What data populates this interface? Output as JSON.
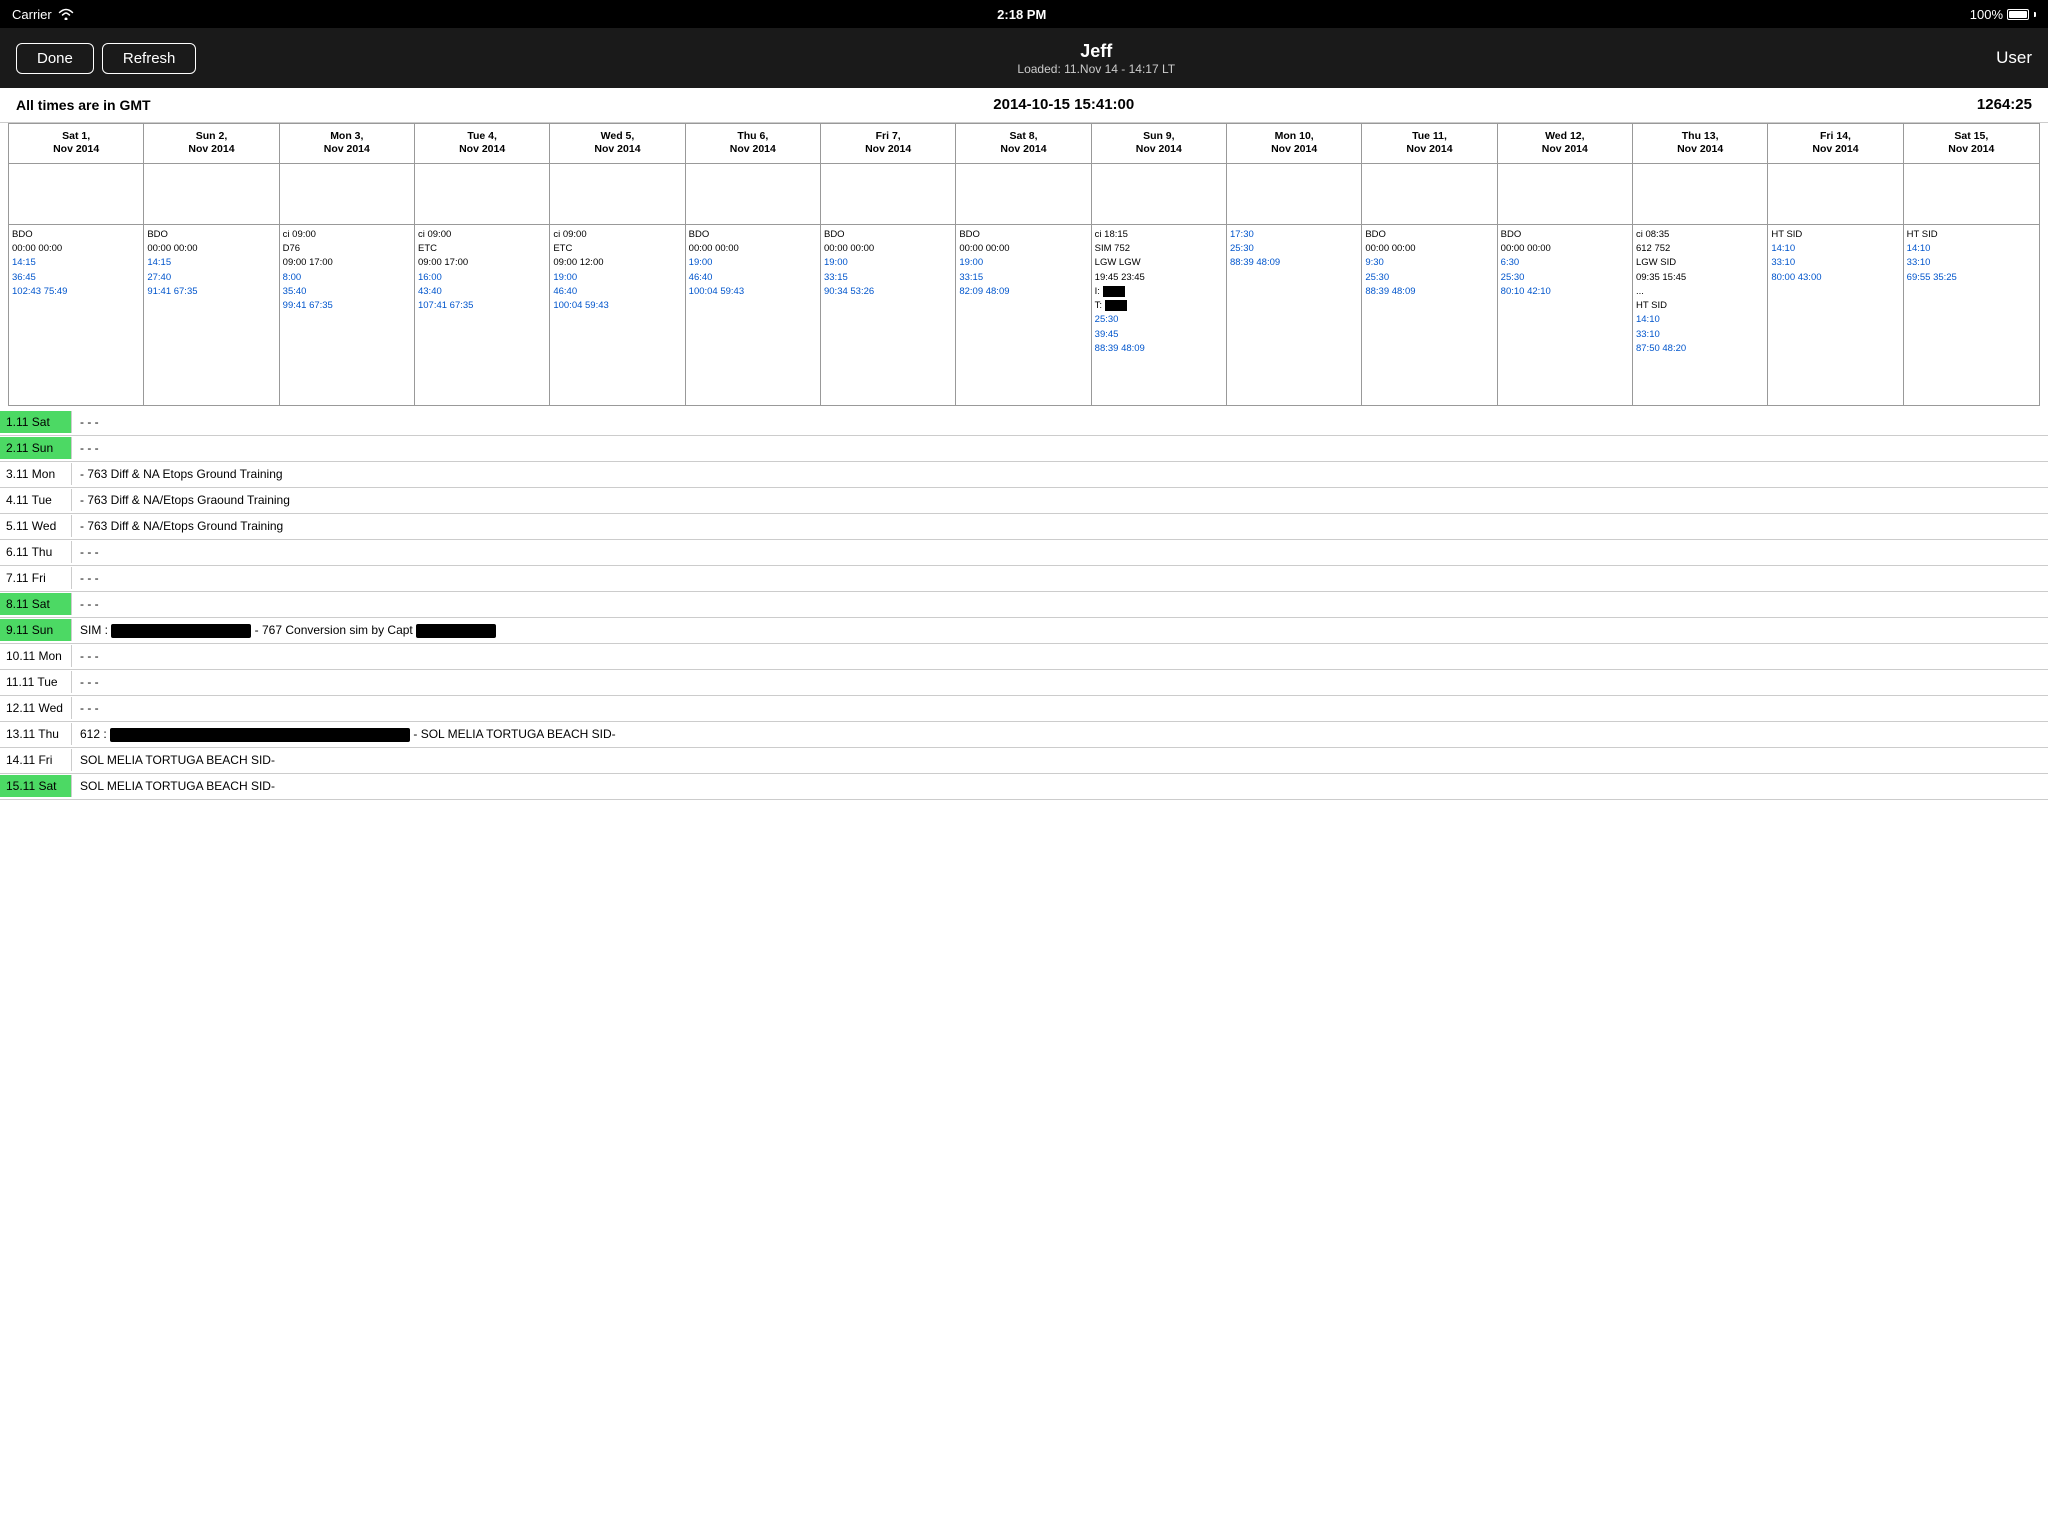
{
  "statusBar": {
    "carrier": "Carrier",
    "time": "2:18 PM",
    "battery": "100%"
  },
  "navBar": {
    "doneLabel": "Done",
    "refreshLabel": "Refresh",
    "title": "Jeff",
    "subtitle": "Loaded: 11.Nov 14 - 14:17 LT",
    "userLabel": "User"
  },
  "headerInfo": {
    "timezoneNote": "All times are in GMT",
    "currentDateTime": "2014-10-15 15:41:00",
    "duration": "1264:25"
  },
  "dayHeaders": [
    {
      "line1": "Sat 1,",
      "line2": "Nov 2014"
    },
    {
      "line1": "Sun 2,",
      "line2": "Nov 2014"
    },
    {
      "line1": "Mon 3,",
      "line2": "Nov 2014"
    },
    {
      "line1": "Tue 4,",
      "line2": "Nov 2014"
    },
    {
      "line1": "Wed 5,",
      "line2": "Nov 2014"
    },
    {
      "line1": "Thu 6,",
      "line2": "Nov 2014"
    },
    {
      "line1": "Fri 7,",
      "line2": "Nov 2014"
    },
    {
      "line1": "Sat 8,",
      "line2": "Nov 2014"
    },
    {
      "line1": "Sun 9,",
      "line2": "Nov 2014"
    },
    {
      "line1": "Mon 10,",
      "line2": "Nov 2014"
    },
    {
      "line1": "Tue 11,",
      "line2": "Nov 2014"
    },
    {
      "line1": "Wed 12,",
      "line2": "Nov 2014"
    },
    {
      "line1": "Thu 13,",
      "line2": "Nov 2014"
    },
    {
      "line1": "Fri 14,",
      "line2": "Nov 2014"
    },
    {
      "line1": "Sat 15,",
      "line2": "Nov 2014"
    }
  ],
  "flightCells": [
    {
      "lines": [
        "BDO",
        "00:00  00:00",
        "",
        "14:15",
        "36:45",
        "102:43 75:49"
      ]
    },
    {
      "lines": [
        "BDO",
        "00:00  00:00",
        "",
        "14:15",
        "27:40",
        "91:41  67:35"
      ]
    },
    {
      "lines": [
        "ci  09:00",
        "D76",
        "09:00  17:00",
        "8:00",
        "35:40",
        "99:41  67:35"
      ]
    },
    {
      "lines": [
        "ci  09:00",
        "ETC",
        "09:00  17:00",
        "16:00",
        "43:40",
        "107:41 67:35"
      ]
    },
    {
      "lines": [
        "ci  09:00",
        "ETC",
        "09:00  12:00",
        "19:00",
        "46:40",
        "100:04 59:43"
      ]
    },
    {
      "lines": [
        "BDO",
        "00:00  00:00",
        "",
        "19:00",
        "46:40",
        "100:04 59:43"
      ]
    },
    {
      "lines": [
        "BDO",
        "00:00  00:00",
        "",
        "19:00",
        "33:15",
        "90:34  53:26"
      ]
    },
    {
      "lines": [
        "BDO",
        "00:00  00:00",
        "",
        "19:00",
        "33:15",
        "82:09  48:09"
      ]
    },
    {
      "lines": [
        "ci  18:15",
        "SIM  752",
        "LGW  LGW",
        "19:45  23:45",
        "I: [R]",
        "T: [R]",
        "25:30",
        "39:45",
        "88:39  48:09"
      ]
    },
    {
      "lines": [
        "17:30",
        "25:30",
        "88:39  48:09"
      ]
    },
    {
      "lines": [
        "BDO",
        "00:00  00:00",
        "",
        "9:30",
        "25:30",
        "88:39  48:09"
      ]
    },
    {
      "lines": [
        "BDO",
        "00:00  00:00",
        "",
        "6:30",
        "25:30",
        "80:10  42:10"
      ]
    },
    {
      "lines": [
        "ci  08:35",
        "612  752",
        "LGW  SID",
        "09:35  15:45",
        "...",
        "HT  SID",
        "",
        "14:10",
        "33:10",
        "87:50  48:20"
      ]
    },
    {
      "lines": [
        "HT  SID",
        "",
        "14:10",
        "33:10",
        "80:00  43:00"
      ]
    },
    {
      "lines": [
        "HT  SID",
        "",
        "14:10",
        "33:10",
        "69:55  35:25"
      ]
    }
  ],
  "dayList": [
    {
      "label": "1.11 Sat",
      "content": "- - -",
      "weekend": true
    },
    {
      "label": "2.11 Sun",
      "content": "- - -",
      "weekend": true
    },
    {
      "label": "3.11 Mon",
      "content": "- 763 Diff & NA Etops Ground Training",
      "weekend": false
    },
    {
      "label": "4.11 Tue",
      "content": "- 763 Diff & NA/Etops Graound Training",
      "weekend": false
    },
    {
      "label": "5.11 Wed",
      "content": "- 763 Diff & NA/Etops Ground Training",
      "weekend": false
    },
    {
      "label": "6.11 Thu",
      "content": "- - -",
      "weekend": false
    },
    {
      "label": "7.11 Fri",
      "content": "- - -",
      "weekend": false
    },
    {
      "label": "8.11 Sat",
      "content": "- - -",
      "weekend": true
    },
    {
      "label": "9.11 Sun",
      "content": "SIM : [REDACTED] - 767 Conversion sim by Capt [REDACTED]",
      "weekend": true,
      "hasRedacted": true
    },
    {
      "label": "10.11 Mon",
      "content": "- - -",
      "weekend": false
    },
    {
      "label": "11.11 Tue",
      "content": "- - -",
      "weekend": false
    },
    {
      "label": "12.11 Wed",
      "content": "- - -",
      "weekend": false
    },
    {
      "label": "13.11 Thu",
      "content": "612 : [REDACTED] - SOL MELIA TORTUGA BEACH SID-",
      "weekend": false,
      "hasRedacted612": true
    },
    {
      "label": "14.11 Fri",
      "content": "SOL MELIA TORTUGA BEACH SID-",
      "weekend": false
    },
    {
      "label": "15.11 Sat",
      "content": "SOL MELIA TORTUGA BEACH SID-",
      "weekend": true
    }
  ]
}
